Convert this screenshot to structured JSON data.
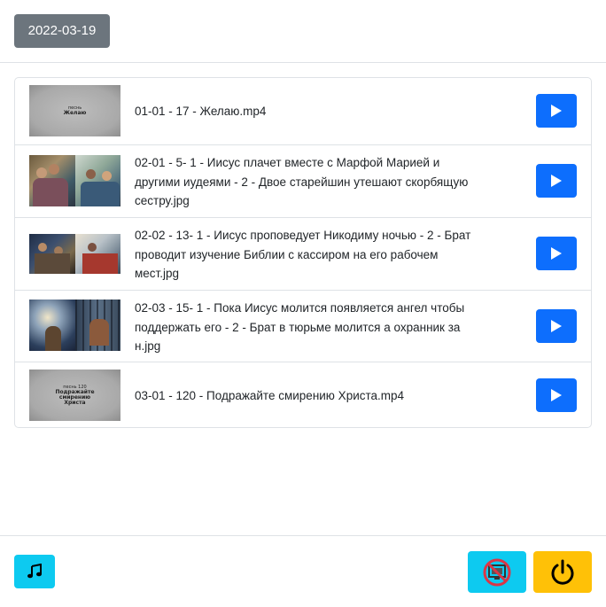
{
  "header": {
    "date_label": "2022-03-19"
  },
  "playlist": {
    "items": [
      {
        "title": "01-01 - 17 - Желаю.mp4",
        "thumb_type": "video",
        "thumb_lines": [
          "песнь",
          "Желаю",
          ""
        ]
      },
      {
        "title": "02-01 - 5- 1 - Иисус плачет вместе с Марфой Марией и другими иудеями - 2 - Двое старейшин утешают скорбящую сестру.jpg",
        "thumb_type": "photo"
      },
      {
        "title": "02-02 - 13- 1 - Иисус проповедует Никодиму ночью - 2 - Брат проводит изучение Библии с кассиром на его рабочем мест.jpg",
        "thumb_type": "photo"
      },
      {
        "title": "02-03 - 15- 1 - Пока Иисус молится появляется ангел чтобы поддержать его - 2 - Брат в тюрьме молится а охранник за н.jpg",
        "thumb_type": "photo"
      },
      {
        "title": "03-01 - 120 - Подражайте смирению Христа.mp4",
        "thumb_type": "video",
        "thumb_lines": [
          "песнь 120",
          "Подражайте смирению Христа",
          ""
        ]
      }
    ]
  },
  "footer": {
    "music_icon": "music-note-icon",
    "screen_icon": "screen-off-icon",
    "power_icon": "power-icon"
  },
  "colors": {
    "secondary": "#6c757d",
    "primary": "#0d6efd",
    "info": "#0dcaf0",
    "warning": "#ffc107"
  }
}
